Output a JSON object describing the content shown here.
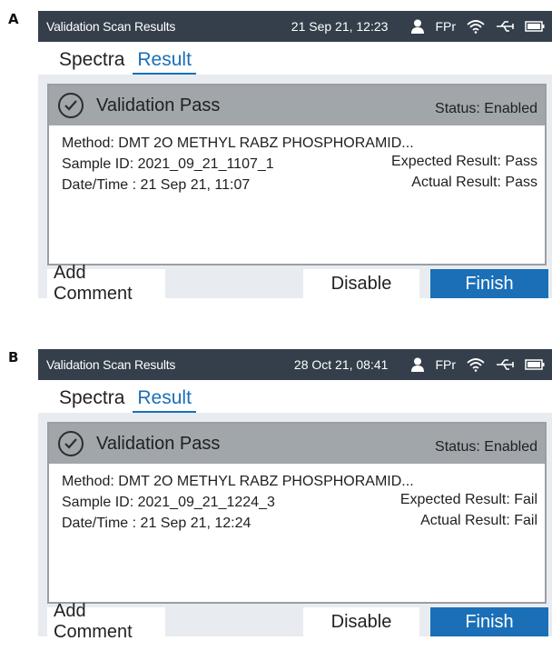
{
  "panels": [
    {
      "letter": "A",
      "statusbar": {
        "title": "Validation Scan Results",
        "datetime": "21 Sep 21, 12:23",
        "user": "FPr"
      },
      "tabs": [
        "Spectra",
        "Result"
      ],
      "card": {
        "title": "Validation Pass",
        "status": "Status: Enabled",
        "method": "Method:  DMT 2O METHYL RABZ PHOSPHORAMID...",
        "sample": "Sample ID:  2021_09_21_1107_1",
        "datetime": "Date/Time :  21 Sep 21, 11:07",
        "expected": "Expected Result:  Pass",
        "actual": "Actual Result:  Pass"
      },
      "buttons": {
        "comment": "Add Comment",
        "disable": "Disable",
        "finish": "Finish"
      }
    },
    {
      "letter": "B",
      "statusbar": {
        "title": "Validation Scan Results",
        "datetime": "28 Oct 21, 08:41",
        "user": "FPr"
      },
      "tabs": [
        "Spectra",
        "Result"
      ],
      "card": {
        "title": "Validation Pass",
        "status": "Status: Enabled",
        "method": "Method:  DMT 2O METHYL RABZ PHOSPHORAMID...",
        "sample": "Sample ID:  2021_09_21_1224_3",
        "datetime": "Date/Time :  21 Sep 21, 12:24",
        "expected": "Expected Result:  Fail",
        "actual": "Actual Result:  Fail"
      },
      "buttons": {
        "comment": "Add Comment",
        "disable": "Disable",
        "finish": "Finish"
      }
    }
  ],
  "colors": {
    "statusbar_bg": "#343f4b",
    "accent": "#1a6fb7",
    "card_header_bg": "#a1a6ab",
    "device_bg": "#e8ecf0"
  },
  "icons": [
    "user-icon",
    "wifi-icon",
    "usb-icon",
    "battery-icon",
    "check-circle-icon"
  ]
}
